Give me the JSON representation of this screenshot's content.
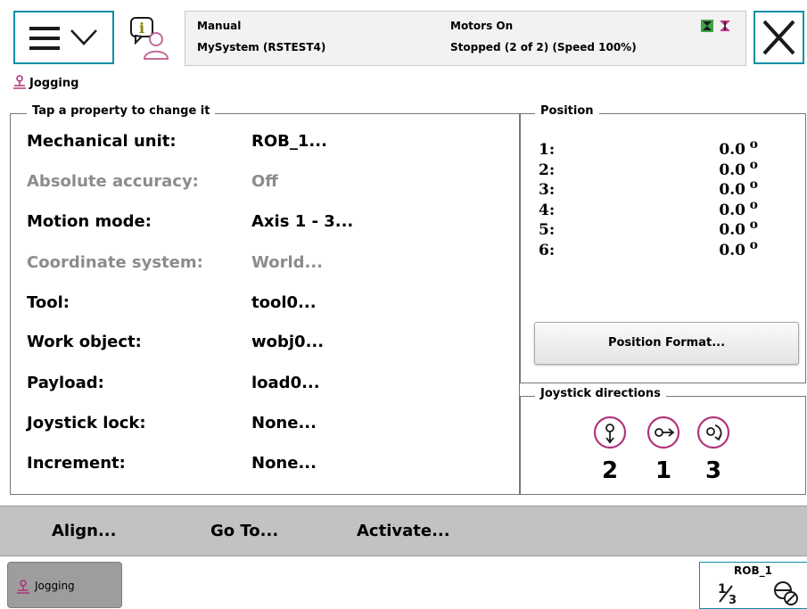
{
  "header": {
    "menu_icon": "hamburger-chevron-icon",
    "info_icon": "event-log-info-icon",
    "operating_mode": "Manual",
    "system_name": "MySystem (RSTEST4)",
    "motors_state": "Motors On",
    "program_state": "Stopped (2 of 2) (Speed 100%)",
    "status_icons": "motors-status-icons",
    "close_icon": "close-x-icon"
  },
  "breadcrumb": {
    "icon": "joystick-person-icon",
    "label": "Jogging"
  },
  "properties": {
    "legend": "Tap a property to change it",
    "rows": [
      {
        "label": "Mechanical unit:",
        "value": "ROB_1...",
        "enabled": true
      },
      {
        "label": "Absolute accuracy:",
        "value": "Off",
        "enabled": false
      },
      {
        "label": "Motion mode:",
        "value": "Axis 1 - 3...",
        "enabled": true
      },
      {
        "label": "Coordinate system:",
        "value": "World...",
        "enabled": false
      },
      {
        "label": "Tool:",
        "value": "tool0...",
        "enabled": true
      },
      {
        "label": "Work object:",
        "value": "wobj0...",
        "enabled": true
      },
      {
        "label": "Payload:",
        "value": "load0...",
        "enabled": true
      },
      {
        "label": "Joystick lock:",
        "value": "None...",
        "enabled": true
      },
      {
        "label": "Increment:",
        "value": "None...",
        "enabled": true
      }
    ]
  },
  "position": {
    "legend": "Position",
    "unit": "o",
    "axes": [
      {
        "name": "1:",
        "value": "0.0"
      },
      {
        "name": "2:",
        "value": "0.0"
      },
      {
        "name": "3:",
        "value": "0.0"
      },
      {
        "name": "4:",
        "value": "0.0"
      },
      {
        "name": "5:",
        "value": "0.0"
      },
      {
        "name": "6:",
        "value": "0.0"
      }
    ],
    "format_button": "Position Format..."
  },
  "joystick": {
    "legend": "Joystick directions",
    "directions": [
      {
        "icon": "joystick-updown-icon",
        "axis": "2"
      },
      {
        "icon": "joystick-leftright-icon",
        "axis": "1"
      },
      {
        "icon": "joystick-twist-icon",
        "axis": "3"
      }
    ]
  },
  "actions": {
    "align": "Align...",
    "goto": "Go To...",
    "activate": "Activate..."
  },
  "taskbar": {
    "jogging_label": "Jogging",
    "quickset_unit": "ROB_1",
    "increment_icon": "increment-icon",
    "stop_icon": "no-increment-icon"
  },
  "colors": {
    "accent": "#0f8fa6",
    "action_bar": "#c2c2c2",
    "disabled_text": "#8c8c8c",
    "task_active": "#9d9d9d"
  }
}
